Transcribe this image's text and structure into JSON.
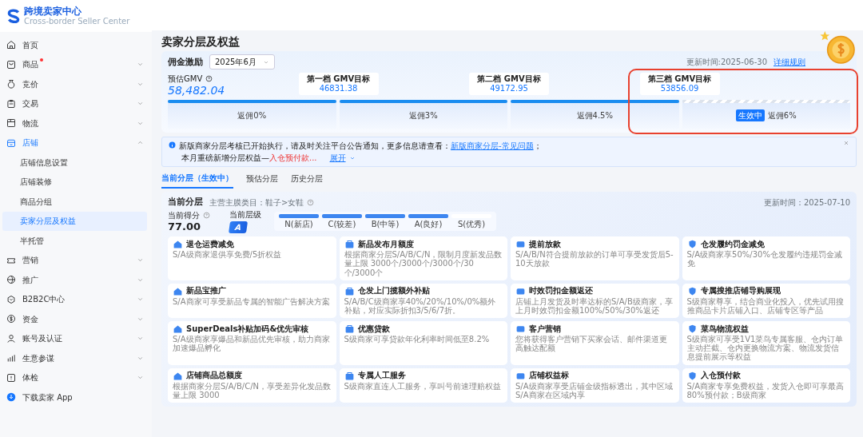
{
  "logo": {
    "title": "跨境卖家中心",
    "subtitle": "Cross-border Seller Center"
  },
  "sidebar": {
    "items": [
      {
        "label": "首页"
      },
      {
        "label": "商品",
        "expanded": false,
        "dot": true
      },
      {
        "label": "竞价",
        "expanded": false
      },
      {
        "label": "交易",
        "expanded": false
      },
      {
        "label": "物流",
        "expanded": false
      },
      {
        "label": "店铺",
        "expanded": true,
        "children": [
          {
            "label": "店铺信息设置",
            "selected": false
          },
          {
            "label": "店铺装修",
            "selected": false
          },
          {
            "label": "商品分组",
            "selected": false
          },
          {
            "label": "卖家分层及权益",
            "selected": true
          },
          {
            "label": "半托管",
            "selected": false
          }
        ]
      },
      {
        "label": "营销",
        "expanded": false
      },
      {
        "label": "推广",
        "expanded": false
      },
      {
        "label": "B2B2C中心",
        "expanded": false
      },
      {
        "label": "资金",
        "expanded": false
      },
      {
        "label": "账号及认证",
        "expanded": false
      },
      {
        "label": "生意参谋",
        "expanded": false
      },
      {
        "label": "体检",
        "expanded": false
      }
    ],
    "download": "下载卖家 App"
  },
  "page_title": "卖家分层及权益",
  "commission": {
    "title": "佣金激励",
    "month": "2025年6月",
    "updated": "更新时间:2025-06-30",
    "rules_link": "详细规则",
    "gmv_label": "预估GMV",
    "gmv_value": "58,482.04",
    "targets": [
      {
        "label": "第一档 GMV目标",
        "value": "46831.38"
      },
      {
        "label": "第二档 GMV目标",
        "value": "49172.95"
      },
      {
        "label": "第三档 GMV目标",
        "value": "53856.09"
      }
    ],
    "segments": [
      {
        "label": "返佣0%",
        "reached": true
      },
      {
        "label": "返佣3%",
        "reached": true
      },
      {
        "label": "返佣4.5%",
        "reached": true
      },
      {
        "label": "返佣6%",
        "reached": false,
        "badge": "生效中"
      }
    ]
  },
  "notice": {
    "text": "新版商家分层考核已开始执行，请及时关注平台公告通知，更多信息请查看：",
    "link": "新版商家分层-常见问题",
    "tail": "；",
    "line2": "本月重磅新增分层权益—",
    "line2_highlight": "入仓预付款...",
    "expand": "展开"
  },
  "tabs": [
    {
      "label": "当前分层（生效中）",
      "selected": true
    },
    {
      "label": "预估分层",
      "selected": false
    },
    {
      "label": "历史分层",
      "selected": false
    }
  ],
  "tier": {
    "title": "当前分层",
    "category": "主营主膜类目：鞋子>女鞋",
    "updated": "更新时间：2025-07-10",
    "score_label": "当前得分",
    "score": "77.00",
    "level_label": "当前层级",
    "level": "A",
    "levels": [
      {
        "label": "N(新店)",
        "reached": true
      },
      {
        "label": "C(较差)",
        "reached": true
      },
      {
        "label": "B(中等)",
        "reached": true
      },
      {
        "label": "A(良好)",
        "reached": true
      },
      {
        "label": "S(优秀)",
        "reached": false
      }
    ]
  },
  "benefits": [
    {
      "title": "退仓运费减免",
      "desc": "S/A级商家退供享免费/5折权益"
    },
    {
      "title": "新品发布月额度",
      "desc": "根据商家分层S/A/B/C/N，限制月度新发品数量上限 3000个/3000个/3000个/30个/3000个"
    },
    {
      "title": "提前放款",
      "desc": "S/A/B/N符合提前放款的订单可享受发货后5-10天放款"
    },
    {
      "title": "仓发履约罚金减免",
      "desc": "S/A级商家享50%/30%仓发履约违规罚金减免"
    },
    {
      "title": "新品宝推广",
      "desc": "S/A商家可享受新品专属的智能广告解决方案"
    },
    {
      "title": "仓发上门揽额外补贴",
      "desc": "S/A/B/C级商家享40%/20%/10%/0%额外补贴，对应实际折扣3/5/6/7折。"
    },
    {
      "title": "时效罚扣金额返还",
      "desc": "店铺上月发货及时率达标的S/A/B级商家，享上月时效罚扣金额100%/50%/30%返还"
    },
    {
      "title": "专属搜推店铺导购展现",
      "desc": "S级商家尊享，结合商业化投入，优先试用搜推商品卡片店铺入口、店铺专区等产品"
    },
    {
      "title": "SuperDeals补贴加码&优先审核",
      "desc": "S/A级商家享爆品和新品优先审核，助力商家加速爆品孵化"
    },
    {
      "title": "优惠贷款",
      "desc": "S级商家可享贷款年化利率时间低至8.2%"
    },
    {
      "title": "客户营销",
      "desc": "您将获得客户营销下买家会话、邮件渠道更高触达配额"
    },
    {
      "title": "菜鸟物流权益",
      "desc": "S级商家可享受1V1菜鸟专属客服、仓内订单主动拦截、仓内更换物流方案、物流发货信息提前展示等权益"
    },
    {
      "title": "店铺商品总额度",
      "desc": "根据商家分层S/A/B/C/N，享受差异化发品数量上限 3000"
    },
    {
      "title": "专属人工服务",
      "desc": "S级商家直连人工服务，享叫号前速理赔权益"
    },
    {
      "title": "店铺权益标",
      "desc": "S/A级商家享受店铺金级指标透出，其中区域S/A商家在区域内享"
    },
    {
      "title": "入仓预付款",
      "desc": "S/A商家专享免费权益，发货入仓即可享最高80%预付款；B级商家"
    }
  ]
}
